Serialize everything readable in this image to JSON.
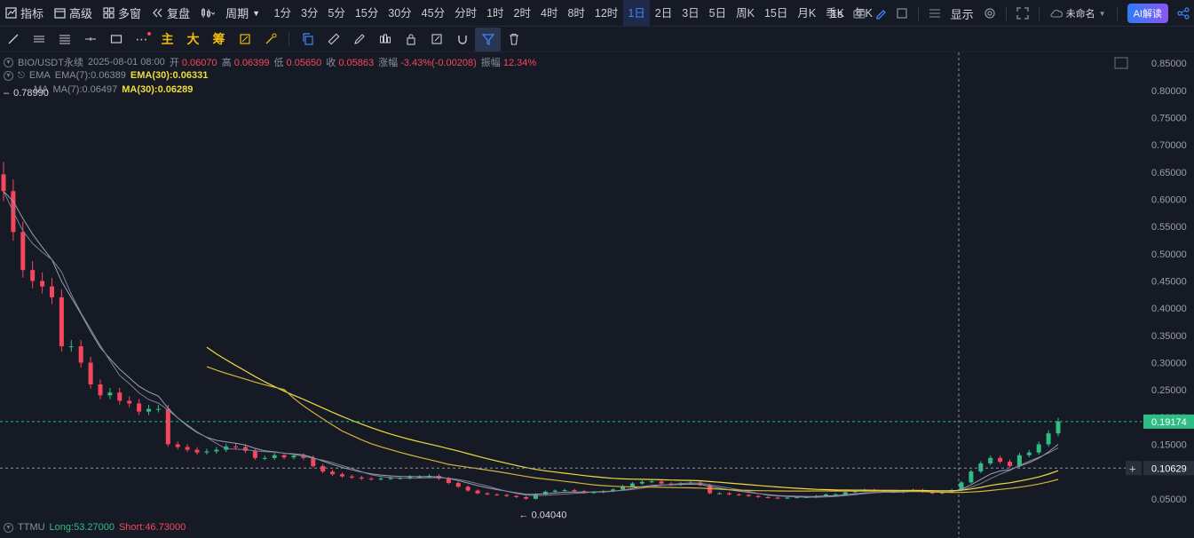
{
  "toolbar": {
    "indicators": "指标",
    "advanced": "高级",
    "multi_window": "多窗",
    "replay": "复盘",
    "period_label": "周期",
    "periods": [
      "1分",
      "3分",
      "5分",
      "15分",
      "30分",
      "45分",
      "分时",
      "1时",
      "2时",
      "4时",
      "8时",
      "12时",
      "1日",
      "2日",
      "3日",
      "5日",
      "周K",
      "15日",
      "月K",
      "季K",
      "年K"
    ],
    "active_period": "1日",
    "resolution_1s": "1s",
    "display": "显示",
    "untitled": "未命名",
    "ai_button": "AI解读"
  },
  "toolbar2": {
    "main_label": "主",
    "big_label": "大",
    "chips_label": "筹"
  },
  "legend": {
    "symbol": "BIO/USDT永续",
    "datetime": "2025-08-01 08:00",
    "open_label": "开",
    "open": "0.06070",
    "high_label": "高",
    "high": "0.06399",
    "low_label": "低",
    "low": "0.05650",
    "close_label": "收",
    "close": "0.05863",
    "change_label": "涨幅",
    "change": "-3.43%(-0.00208)",
    "amp_label": "振幅",
    "amplitude": "12.34%",
    "ema_name": "EMA",
    "ema7": "EMA(7):0.06389",
    "ema30": "EMA(30):0.06331",
    "ma_name": "MA",
    "ma7": "MA(7):0.06497",
    "ma30": "MA(30):0.06289",
    "max_marker": "0.78990",
    "min_marker": "0.04040"
  },
  "price_axis": {
    "ticks": [
      "0.85000",
      "0.80000",
      "0.75000",
      "0.70000",
      "0.65000",
      "0.60000",
      "0.55000",
      "0.50000",
      "0.45000",
      "0.40000",
      "0.35000",
      "0.30000",
      "0.25000",
      "0.20000",
      "0.15000",
      "0.10000",
      "0.05000"
    ],
    "last_price": "0.19174",
    "crosshair_price": "0.10629"
  },
  "ttmu": {
    "name": "TTMU",
    "long": "Long:53.27000",
    "short": "Short:46.73000"
  },
  "colors": {
    "up": "#2ebd85",
    "down": "#f6465d",
    "ema30": "#f0dc3c",
    "ma30": "#d4b33a",
    "background": "#161a25",
    "accent": "#3f86ff"
  },
  "chart_data": {
    "type": "candlestick",
    "close": [
      0.615,
      0.54,
      0.47,
      0.45,
      0.44,
      0.42,
      0.33,
      0.33,
      0.3,
      0.26,
      0.24,
      0.245,
      0.23,
      0.225,
      0.21,
      0.215,
      0.215,
      0.15,
      0.145,
      0.14,
      0.135,
      0.137,
      0.14,
      0.146,
      0.145,
      0.138,
      0.125,
      0.125,
      0.13,
      0.126,
      0.129,
      0.125,
      0.11,
      0.1,
      0.095,
      0.091,
      0.089,
      0.087,
      0.086,
      0.087,
      0.088,
      0.088,
      0.09,
      0.09,
      0.092,
      0.087,
      0.079,
      0.072,
      0.065,
      0.06,
      0.058,
      0.057,
      0.055,
      0.053,
      0.05,
      0.058,
      0.063,
      0.065,
      0.066,
      0.064,
      0.061,
      0.062,
      0.064,
      0.067,
      0.073,
      0.078,
      0.081,
      0.082,
      0.078,
      0.076,
      0.078,
      0.08,
      0.075,
      0.06,
      0.06,
      0.058,
      0.057,
      0.055,
      0.053,
      0.052,
      0.051,
      0.052,
      0.053,
      0.053,
      0.055,
      0.058,
      0.058,
      0.062,
      0.064,
      0.066,
      0.064,
      0.063,
      0.062,
      0.064,
      0.066,
      0.063,
      0.06,
      0.062,
      0.066,
      0.08,
      0.1,
      0.115,
      0.125,
      0.118,
      0.11,
      0.13,
      0.135,
      0.15,
      0.17,
      0.192
    ],
    "ema30_start_index": 21,
    "ma30_start_index": 21,
    "ylim": [
      0.035,
      0.86
    ],
    "last_price": 0.19174,
    "crosshair_price": 0.10629
  }
}
